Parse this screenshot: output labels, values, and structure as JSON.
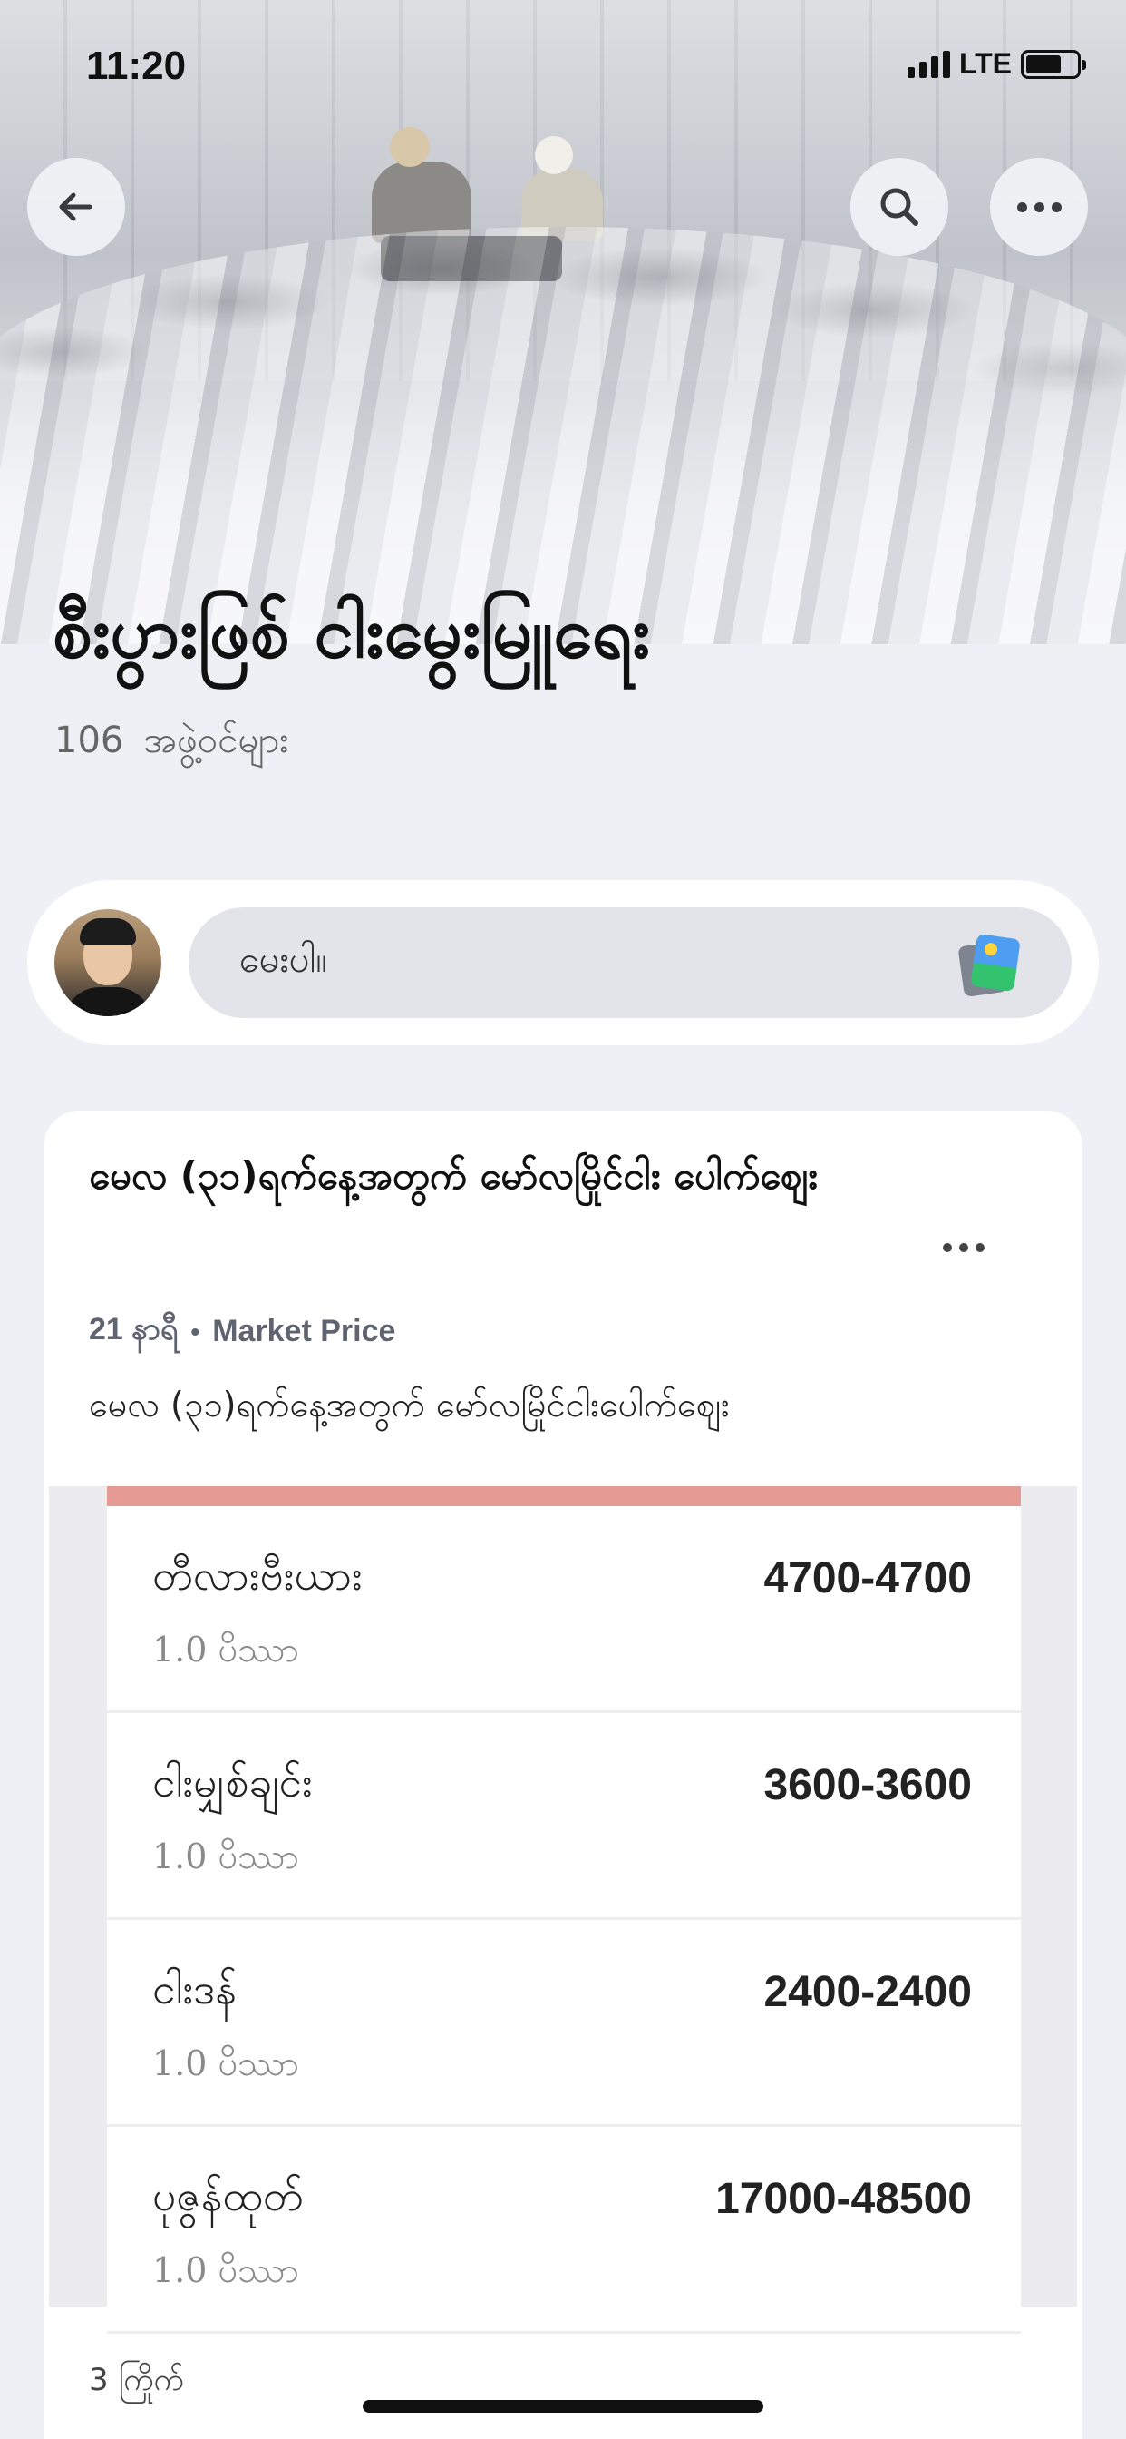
{
  "status_bar": {
    "time": "11:20",
    "network": "LTE"
  },
  "group": {
    "title": "စီးပွားဖြစ် ငါးမွေးမြူရေး",
    "member_count": "106",
    "member_label": "အဖွဲ့ဝင်များ"
  },
  "composer": {
    "placeholder": "မေးပါ။"
  },
  "post": {
    "title": "မေလ (၃၁)ရက်နေ့အတွက် မော်လမြိုင်ငါး ပေါက်စျေး",
    "time_ago": "21 နာရီ",
    "topic": "Market Price",
    "body": "မေလ (၃၁)ရက်နေ့အတွက် မော်လမြိုင်ငါးပေါက်စျေး",
    "prices": [
      {
        "name": "တီလားဗီးယား",
        "unit": "1.0 ပိဿာ",
        "price": "4700-4700"
      },
      {
        "name": "ငါးမျှစ်ချင်း",
        "unit": "1.0 ပိဿာ",
        "price": "3600-3600"
      },
      {
        "name": "ငါးဒန်",
        "unit": "1.0 ပိဿာ",
        "price": "2400-2400"
      },
      {
        "name": "ပုဇွန်ထုတ်",
        "unit": "1.0 ပိဿာ",
        "price": "17000-48500"
      }
    ],
    "comments": "3 ကြိုက်"
  },
  "icons": {
    "back": "arrow-left-icon",
    "search": "search-icon",
    "more": "more-icon",
    "photo": "photo-icon"
  },
  "colors": {
    "accent_bar": "#e69a94",
    "background": "#eff0f5"
  }
}
